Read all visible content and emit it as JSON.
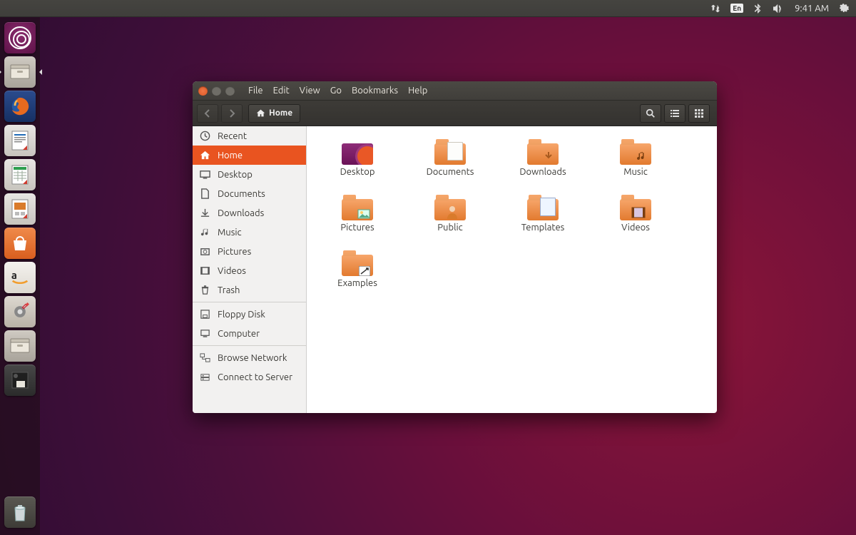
{
  "top_panel": {
    "lang": "En",
    "time": "9:41 AM"
  },
  "launcher": {
    "items": [
      "dash",
      "files",
      "firefox",
      "writer",
      "calc",
      "impress",
      "software",
      "amazon",
      "settings",
      "archive",
      "disks"
    ]
  },
  "window": {
    "menu": {
      "file": "File",
      "edit": "Edit",
      "view": "View",
      "go": "Go",
      "bookmarks": "Bookmarks",
      "help": "Help"
    },
    "location_label": "Home"
  },
  "sidebar": {
    "recent": "Recent",
    "home": "Home",
    "desktop": "Desktop",
    "documents": "Documents",
    "downloads": "Downloads",
    "music": "Music",
    "pictures": "Pictures",
    "videos": "Videos",
    "trash": "Trash",
    "floppy": "Floppy Disk",
    "computer": "Computer",
    "browse_network": "Browse Network",
    "connect_server": "Connect to Server"
  },
  "folders": {
    "desktop": "Desktop",
    "documents": "Documents",
    "downloads": "Downloads",
    "music": "Music",
    "pictures": "Pictures",
    "public": "Public",
    "templates": "Templates",
    "videos": "Videos",
    "examples": "Examples"
  }
}
